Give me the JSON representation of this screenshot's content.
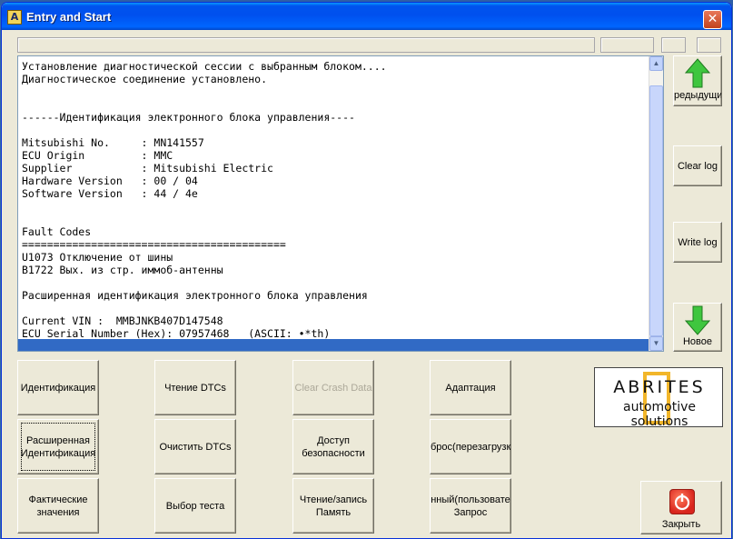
{
  "window": {
    "title": "Entry and Start",
    "app_icon_letter": "A"
  },
  "log": {
    "lines": [
      "Установление диагностической сессии с выбранным блоком....",
      "Диагностическое соединение установлено.",
      "",
      "",
      "------Идентификация электронного блока управления----",
      "",
      "Mitsubishi No.     : MN141557",
      "ECU Origin         : MMC",
      "Supplier           : Mitsubishi Electric",
      "Hardware Version   : 00 / 04",
      "Software Version   : 44 / 4e",
      "",
      "",
      "Fault Codes",
      "==========================================",
      "U1073 Отключение от шины",
      "B1722 Вых. из стр. иммоб-антенны",
      "",
      "Расширенная идентификация электронного блока управления",
      "",
      "Current VIN :  MMBJNKB407D147548",
      "ECU Serial Number (Hex): 07957468   (ASCII: •*th)"
    ]
  },
  "side_buttons": {
    "previous_label": "редыдущи",
    "clear_log_label": "Clear log",
    "write_log_label": "Write log",
    "new_label": "Новое"
  },
  "function_buttons": {
    "identification": "Идентификация",
    "read_dtcs": "Чтение DTCs",
    "clear_crash_data": "Clear Crash Data",
    "adaptation": "Адаптация",
    "extended_identification": "Расширенная Идентификация",
    "clear_dtcs": "Очистить DTCs",
    "security_access": "Доступ безопасности",
    "reset": "брос(перезагрузка",
    "actual_values": "Фактические значения",
    "test_selection": "Выбор теста",
    "read_write_memory": "Чтение/запись Память",
    "user_request": "нный(пользовате Запрос"
  },
  "logo": {
    "main": "ABRITES",
    "sub": "automotive solutions"
  },
  "close_action": {
    "label": "Закрыть"
  },
  "colors": {
    "titlebar": "#0053ee",
    "selection": "#316ac5",
    "arrow_green": "#2fb52f",
    "logo_frame": "#f2b62a"
  }
}
